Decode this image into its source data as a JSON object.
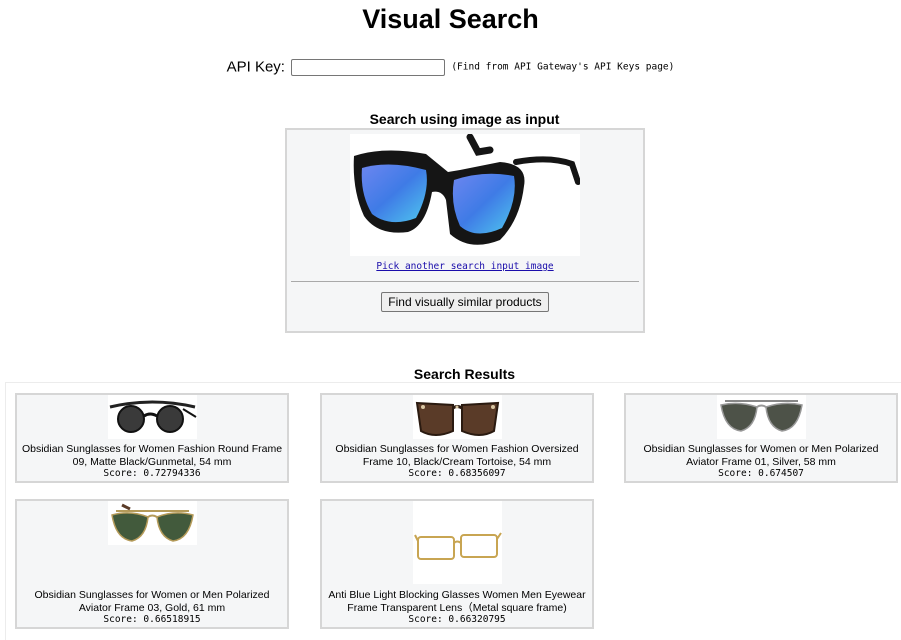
{
  "page": {
    "title": "Visual Search"
  },
  "api": {
    "label": "API Key:",
    "value": "",
    "hint": "(Find from API Gateway's API Keys page)"
  },
  "search_input": {
    "heading": "Search using image as input",
    "image": "blue-mirror-lens-wayfarer-sunglasses",
    "pick_link": "Pick another search input image",
    "find_button": "Find visually similar products"
  },
  "results": {
    "heading": "Search Results",
    "items": [
      {
        "name": "Obsidian Sunglasses for Women Fashion Round Frame 09, Matte Black/Gunmetal, 54 mm",
        "score": "Score: 0.72794336",
        "image": "black-round-sunglasses"
      },
      {
        "name": "Obsidian Sunglasses for Women Fashion Oversized Frame 10, Black/Cream Tortoise, 54 mm",
        "score": "Score: 0.68356097",
        "image": "tortoise-oversized-sunglasses"
      },
      {
        "name": "Obsidian Sunglasses for Women or Men Polarized Aviator Frame 01, Silver, 58 mm",
        "score": "Score: 0.674507",
        "image": "silver-aviator-sunglasses"
      },
      {
        "name": "Obsidian Sunglasses for Women or Men Polarized Aviator Frame 03, Gold, 61 mm",
        "score": "Score: 0.66518915",
        "image": "gold-aviator-sunglasses"
      },
      {
        "name": "Anti Blue Light Blocking Glasses Women Men Eyewear Frame Transparent Lens（Metal square frame)",
        "score": "Score: 0.66320795",
        "image": "gold-metal-square-eyeglasses"
      }
    ]
  }
}
